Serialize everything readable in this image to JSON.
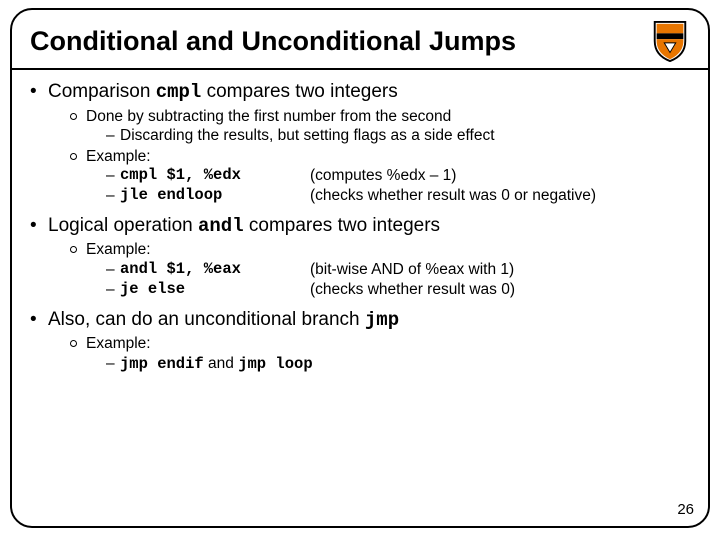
{
  "title": "Conditional and Unconditional Jumps",
  "sec1": {
    "lead_a": "Comparison ",
    "lead_code": "cmpl",
    "lead_b": " compares two integers",
    "p1": "Done by subtracting the first number from the second",
    "p1a": "Discarding the results, but setting flags as a side effect",
    "p2": "Example:",
    "c1": "cmpl $1, %edx",
    "e1": "(computes %edx – 1)",
    "c2": "jle endloop",
    "e2": "(checks whether result was 0 or negative)"
  },
  "sec2": {
    "lead_a": "Logical operation ",
    "lead_code": "andl",
    "lead_b": " compares two integers",
    "p1": "Example:",
    "c1": "andl $1, %eax",
    "e1": "(bit-wise AND of %eax with 1)",
    "c2": "je else",
    "e2": "(checks whether result was 0)"
  },
  "sec3": {
    "lead_a": "Also, can do an unconditional branch ",
    "lead_code": "jmp",
    "p1": "Example:",
    "c1": "jmp endif",
    "mid": " and ",
    "c2": "jmp loop"
  },
  "pagenum": "26"
}
